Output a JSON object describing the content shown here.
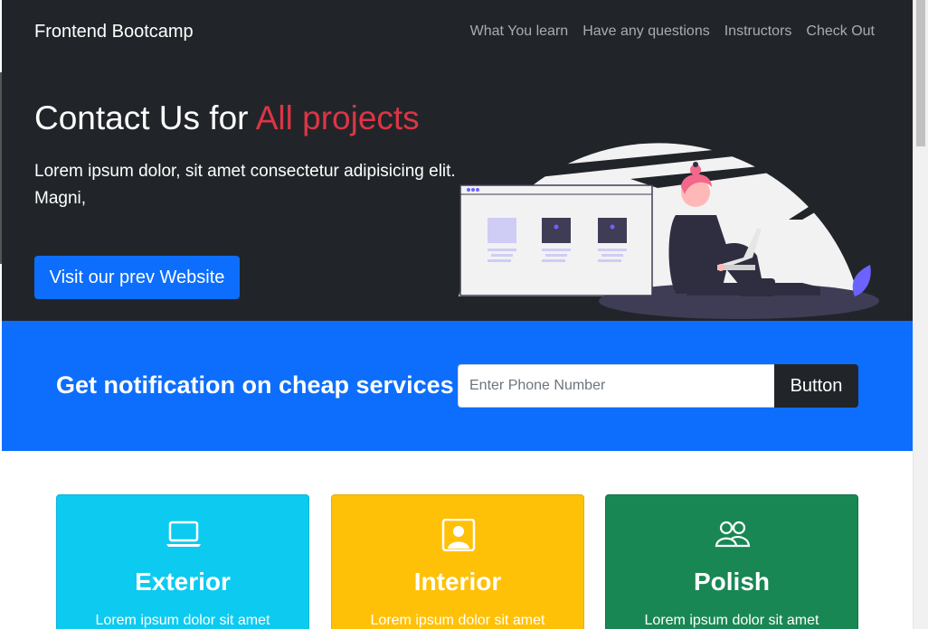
{
  "navbar": {
    "brand": "Frontend Bootcamp",
    "links": [
      "What You learn",
      "Have any questions",
      "Instructors",
      "Check Out"
    ]
  },
  "hero": {
    "title_prefix": "Contact Us for ",
    "title_highlight": "All projects",
    "text": "Lorem ipsum dolor, sit amet consectetur adipisicing elit. Magni,",
    "button_label": "Visit our prev Website",
    "illustration_icon": "person-with-laptop-illustration"
  },
  "notify": {
    "title": "Get notification on cheap services",
    "input_placeholder": "Enter Phone Number",
    "input_value": "",
    "button_label": "Button"
  },
  "cards": [
    {
      "title": "Exterior",
      "text": "Lorem ipsum dolor sit amet",
      "icon": "laptop-icon",
      "color": "#0dcaf0"
    },
    {
      "title": "Interior",
      "text": "Lorem ipsum dolor sit amet",
      "icon": "person-badge-icon",
      "color": "#ffc107"
    },
    {
      "title": "Polish",
      "text": "Lorem ipsum dolor sit amet",
      "icon": "people-icon",
      "color": "#198754"
    }
  ],
  "colors": {
    "dark": "#212529",
    "primary": "#0d6efd",
    "danger": "#dc3545",
    "info": "#0dcaf0",
    "warning": "#ffc107",
    "success": "#198754"
  }
}
